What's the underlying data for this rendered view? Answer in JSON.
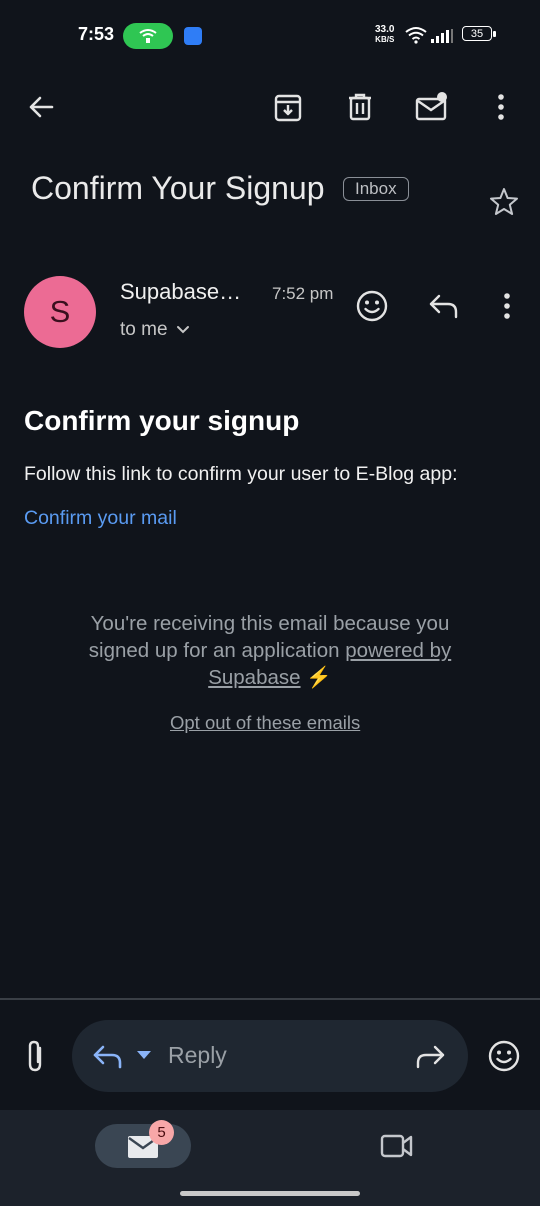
{
  "status_bar": {
    "time": "7:53",
    "net_speed_value": "33.0",
    "net_speed_unit": "KB/S",
    "battery": "35"
  },
  "toolbar": {
    "icons": [
      "back-arrow-icon",
      "archive-icon",
      "delete-icon",
      "mark-unread-icon",
      "more-options-icon"
    ]
  },
  "email": {
    "subject": "Confirm Your Signup",
    "label_chip": "Inbox",
    "sender_initial": "S",
    "sender_name": "Supabase…",
    "time": "7:52 pm",
    "recipient": "to me",
    "body_heading": "Confirm your signup",
    "body_text": "Follow this link to confirm your user to E-Blog app:",
    "confirm_link": "Confirm your mail",
    "footer_text": "You're receiving this email because you signed up for an application",
    "footer_link": "powered by Supabase",
    "footer_emoji": "⚡",
    "optout_link": "Opt out of these emails"
  },
  "reply_bar": {
    "placeholder": "Reply"
  },
  "bottom_nav": {
    "mail_badge": "5"
  },
  "colors": {
    "background": "#10141b",
    "link": "#5a9bf2",
    "avatar": "#ec6b94",
    "hotspot": "#2fc653"
  }
}
